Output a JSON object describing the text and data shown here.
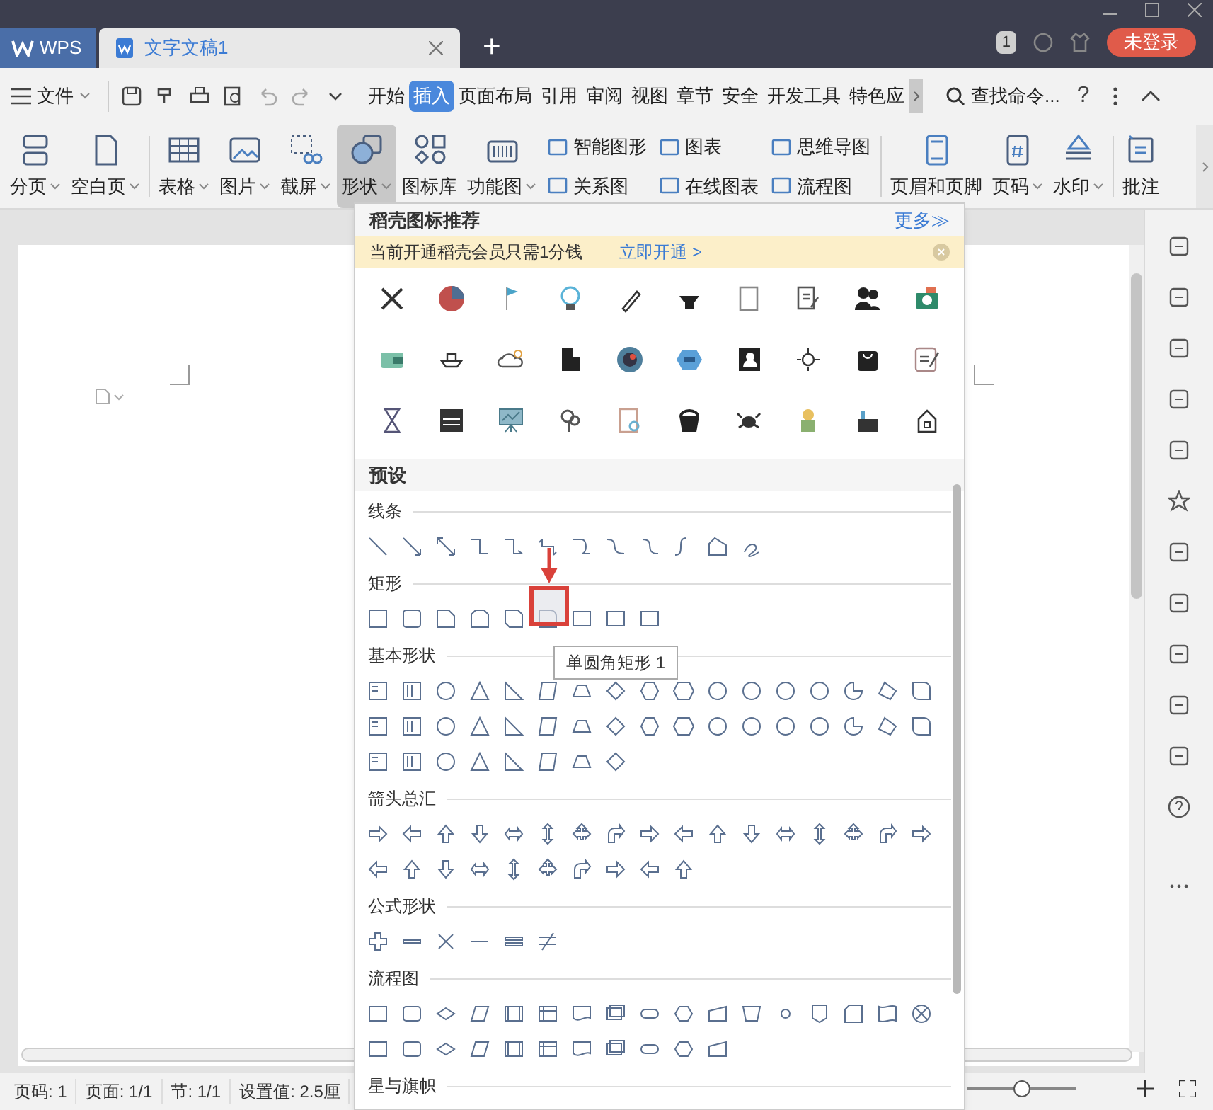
{
  "title_bar": {
    "app_tab": "WPS",
    "doc_tab": "文字文稿1",
    "new_tab": "+",
    "page_badge": "1",
    "login": "未登录"
  },
  "menu_bar": {
    "file": "文件",
    "search": "查找命令...",
    "help": "?",
    "tabs": [
      {
        "label": "开始",
        "selected": false
      },
      {
        "label": "插入",
        "selected": true
      },
      {
        "label": "页面布局",
        "selected": false
      },
      {
        "label": "引用",
        "selected": false
      },
      {
        "label": "审阅",
        "selected": false
      },
      {
        "label": "视图",
        "selected": false
      },
      {
        "label": "章节",
        "selected": false
      },
      {
        "label": "安全",
        "selected": false
      },
      {
        "label": "开发工具",
        "selected": false
      },
      {
        "label": "特色应",
        "selected": false
      }
    ]
  },
  "ribbon": {
    "groups": [
      [
        {
          "kind": "large",
          "label": "分页",
          "dropdown": true,
          "selected": false
        },
        {
          "kind": "large",
          "label": "空白页",
          "dropdown": true,
          "selected": false
        }
      ],
      [
        {
          "kind": "large",
          "label": "表格",
          "dropdown": true,
          "selected": false
        },
        {
          "kind": "large",
          "label": "图片",
          "dropdown": true,
          "selected": false
        },
        {
          "kind": "large",
          "label": "截屏",
          "dropdown": true,
          "selected": false
        },
        {
          "kind": "large",
          "label": "形状",
          "dropdown": true,
          "selected": true
        },
        {
          "kind": "large",
          "label": "图标库",
          "dropdown": false,
          "selected": false
        },
        {
          "kind": "large",
          "label": "功能图",
          "dropdown": true,
          "selected": false
        },
        {
          "kind": "pair",
          "labels": [
            "智能图形",
            "关系图"
          ]
        },
        {
          "kind": "pair",
          "labels": [
            "图表",
            "在线图表"
          ]
        },
        {
          "kind": "pair",
          "labels": [
            "思维导图",
            "流程图"
          ]
        }
      ],
      [
        {
          "kind": "large",
          "label": "页眉和页脚",
          "dropdown": false,
          "selected": false
        },
        {
          "kind": "large",
          "label": "页码",
          "dropdown": true,
          "selected": false
        },
        {
          "kind": "large",
          "label": "水印",
          "dropdown": true,
          "selected": false
        }
      ],
      [
        {
          "kind": "large",
          "label": "批注",
          "dropdown": false,
          "selected": false
        }
      ]
    ]
  },
  "shapes_panel": {
    "header": "稻壳图标推荐",
    "more": "更多≫",
    "promo": {
      "text": "当前开通稻壳会员只需1分钱",
      "link": "立即开通 >"
    },
    "preset_header": "预设",
    "tooltip": "单圆角矩形 1",
    "sections": [
      {
        "title": "线条"
      },
      {
        "title": "矩形"
      },
      {
        "title": "基本形状"
      },
      {
        "title": "箭头总汇"
      },
      {
        "title": "公式形状"
      },
      {
        "title": "流程图"
      },
      {
        "title": "星与旗帜"
      }
    ]
  },
  "status_bar": {
    "items": [
      "页码: 1",
      "页面: 1/1",
      "节: 1/1",
      "设置值: 2.5厘"
    ],
    "zoom": {
      "level": 0.5
    }
  }
}
